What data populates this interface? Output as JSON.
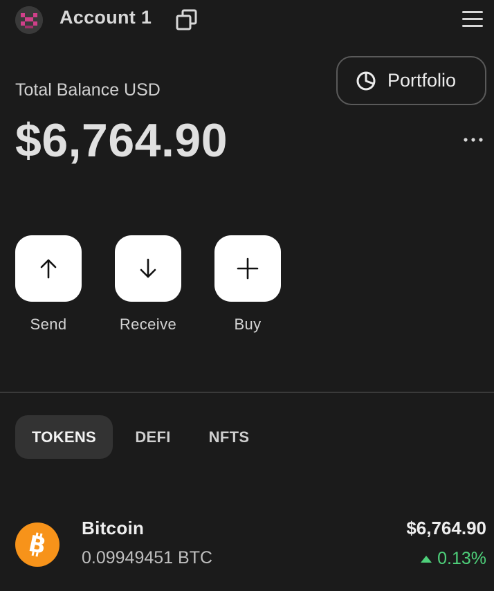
{
  "header": {
    "account_name": "Account 1"
  },
  "portfolio": {
    "label": "Portfolio"
  },
  "balance": {
    "label": "Total Balance USD",
    "value": "$6,764.90"
  },
  "actions": [
    {
      "label": "Send",
      "icon": "arrow-up-icon"
    },
    {
      "label": "Receive",
      "icon": "arrow-down-icon"
    },
    {
      "label": "Buy",
      "icon": "plus-icon"
    }
  ],
  "tabs": [
    {
      "label": "TOKENS",
      "active": true
    },
    {
      "label": "DEFI",
      "active": false
    },
    {
      "label": "NFTS",
      "active": false
    }
  ],
  "tokens": [
    {
      "name": "Bitcoin",
      "amount": "0.09949451 BTC",
      "value": "$6,764.90",
      "change": "0.13%",
      "icon": "bitcoin-icon"
    }
  ],
  "colors": {
    "background": "#1b1b1b",
    "positive": "#4ed07a",
    "bitcoin": "#f7931a",
    "avatar_accent": "#d0408a"
  }
}
